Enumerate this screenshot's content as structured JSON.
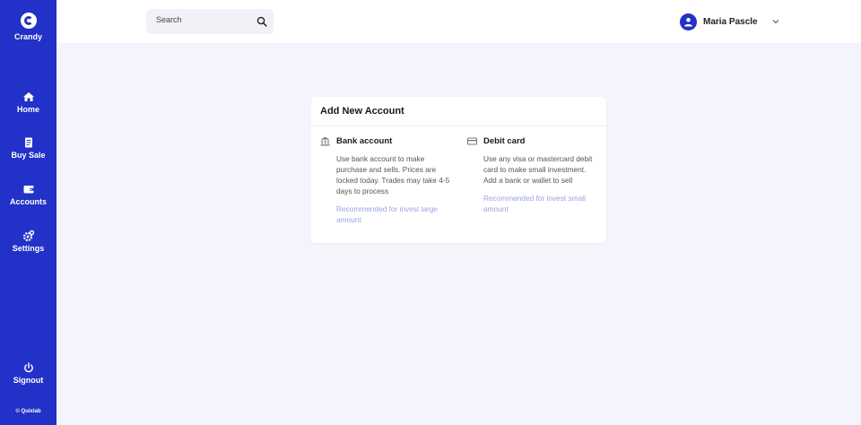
{
  "brand": {
    "name": "Crandy"
  },
  "sidebar": {
    "items": [
      {
        "label": "Home",
        "icon": "home-icon"
      },
      {
        "label": "Buy Sale",
        "icon": "receipt-icon"
      },
      {
        "label": "Accounts",
        "icon": "wallet-icon"
      },
      {
        "label": "Settings",
        "icon": "gear-icon"
      }
    ],
    "signout": {
      "label": "Signout",
      "icon": "power-icon"
    },
    "copyright": "© Quixlab"
  },
  "header": {
    "search": {
      "placeholder": "Search",
      "value": ""
    },
    "user": {
      "name": "Maria Pascle"
    }
  },
  "card": {
    "title": "Add New Account",
    "options": [
      {
        "title": "Bank account",
        "icon": "bank-icon",
        "desc": [
          "Use bank account to make",
          "purchase and sells. Prices are",
          "locked today. Trades may take 4-5",
          "days to process"
        ],
        "rec": [
          "Recommended for invest large",
          "amount"
        ]
      },
      {
        "title": "Debit card",
        "icon": "credit-card-icon",
        "desc": [
          "Use any visa or mastercard debit",
          "card to make small investment.",
          "Add a bank or wallet to sell"
        ],
        "rec": [
          "Recommended for invest small",
          "amount"
        ]
      }
    ]
  },
  "colors": {
    "sidebar": "#2231c7",
    "background": "#f4f5fc",
    "accent_text": "#9aa2e6"
  }
}
